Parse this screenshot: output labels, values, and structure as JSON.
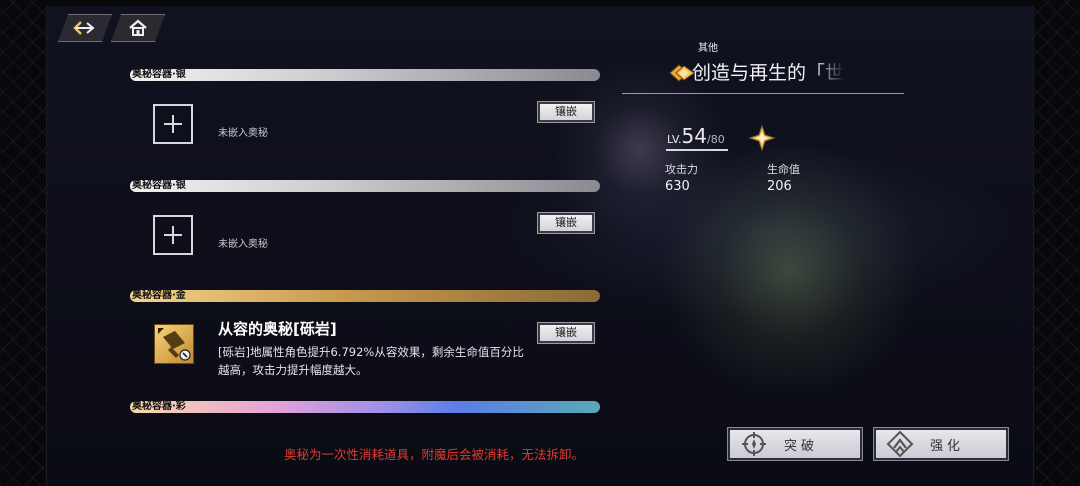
{
  "nav": {
    "back_icon": "back-arrow-icon",
    "home_icon": "home-icon"
  },
  "slots": [
    {
      "header": "奥秘容器·银",
      "tier": "silver",
      "status": "未嵌入奥秘",
      "button": "镶嵌"
    },
    {
      "header": "奥秘容器·银",
      "tier": "silver",
      "status": "未嵌入奥秘",
      "button": "镶嵌"
    },
    {
      "header": "奥秘容器·金",
      "tier": "gold",
      "rune_title": "从容的奥秘[砾岩]",
      "rune_desc": "[砾岩]地属性角色提升6.792%从容效果，剩余生命值百分比越高，攻击力提升幅度越大。",
      "button": "镶嵌"
    },
    {
      "header": "奥秘容器·彩",
      "tier": "rainbow"
    }
  ],
  "warning": "奥秘为一次性消耗道具，附魔后会被消耗，无法拆卸。",
  "weapon": {
    "category": "其他",
    "name": "创造与再生的「世",
    "level_label": "LV.",
    "level": "54",
    "level_max": "/80",
    "stats": [
      {
        "label": "攻击力",
        "value": "630"
      },
      {
        "label": "生命值",
        "value": "206"
      }
    ]
  },
  "actions": {
    "breakthrough": "突破",
    "enhance": "强化"
  },
  "colors": {
    "warning": "#e03a2f",
    "gold_accent": "#f0c35a"
  }
}
